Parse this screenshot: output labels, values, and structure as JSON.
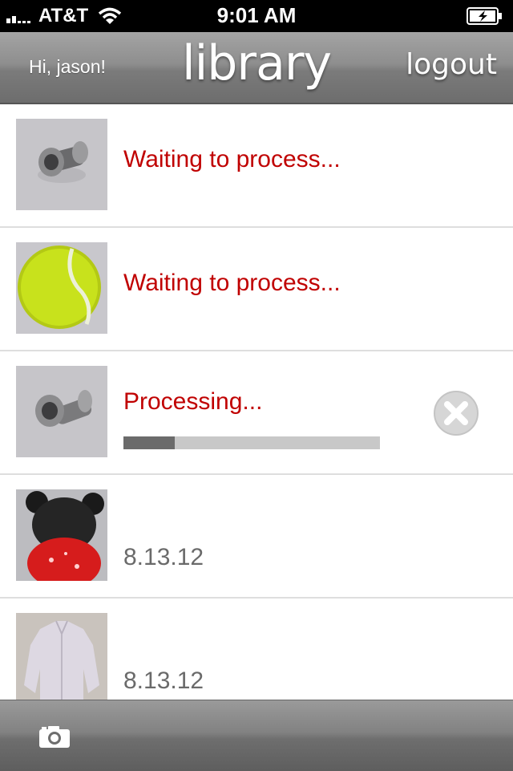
{
  "status_bar": {
    "carrier": "AT&T",
    "time": "9:01 AM"
  },
  "nav": {
    "greeting": "Hi, jason!",
    "title": "library",
    "logout_label": "logout"
  },
  "items": [
    {
      "subject": "bolt",
      "status": "Waiting to process..."
    },
    {
      "subject": "tennis-ball",
      "status": "Waiting to process..."
    },
    {
      "subject": "bolt",
      "status": "Processing...",
      "progress": 0.2
    },
    {
      "subject": "doll",
      "date": "8.13.12"
    },
    {
      "subject": "shirt",
      "date": "8.13.12"
    }
  ],
  "colors": {
    "status_text": "#c00000",
    "date_text": "#6a6a6a",
    "nav_bar": "#8a8a8a",
    "progress_fill": "#6b6b6b",
    "progress_track": "#c8c8c8"
  },
  "icons": {
    "cancel": "close-circle-icon",
    "camera": "camera-icon"
  }
}
